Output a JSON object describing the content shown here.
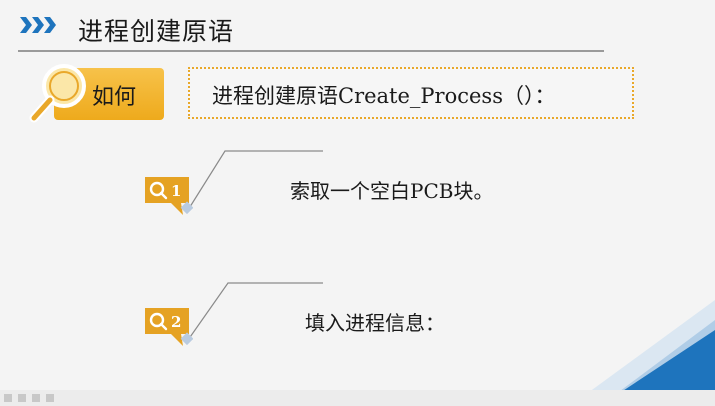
{
  "header": {
    "title": "进程创建原语",
    "icon": "triple-chevron-icon"
  },
  "how": {
    "label": "如何",
    "text": "进程创建原语Create_Process（）：",
    "icon": "magnifier-icon"
  },
  "steps": [
    {
      "number": "1",
      "text": "索取一个空白PCB块。",
      "icon": "search-badge-icon"
    },
    {
      "number": "2",
      "text": "填入进程信息：",
      "icon": "search-badge-icon"
    }
  ],
  "colors": {
    "accent_blue": "#1e74bd",
    "accent_gold": "#eeaa1c",
    "badge_gold": "#e5a223",
    "leader_gray": "#8a8a8a"
  }
}
